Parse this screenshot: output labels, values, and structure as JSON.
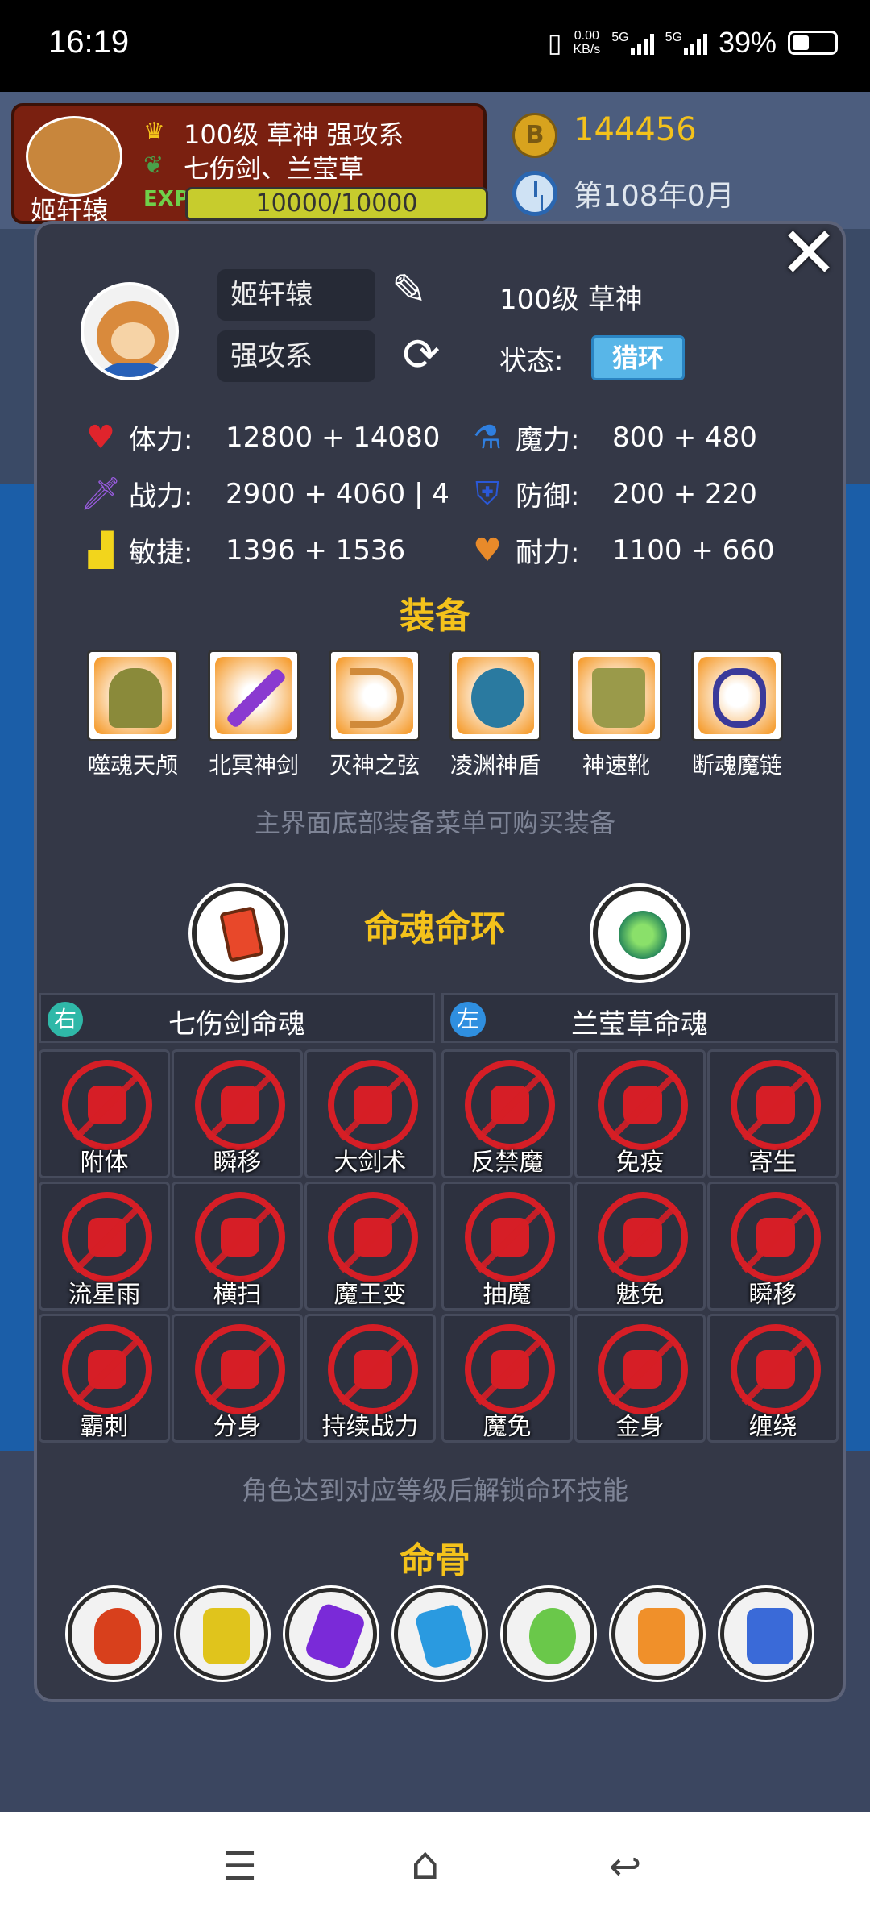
{
  "status_bar": {
    "time": "16:19",
    "net_speed_value": "0.00",
    "net_speed_unit": "KB/s",
    "sig1": "5G",
    "sig2": "5G",
    "battery": "39%",
    "battery_level": 0.39
  },
  "background": {
    "hero_name": "姬轩辕",
    "hero_line1": "100级 草神 强攻系",
    "hero_line2": "七伤剑、兰莹草",
    "exp_label": "EXP",
    "exp_value": "10000/10000",
    "coin_letter": "B",
    "coins": "144456",
    "date": "第108年0月"
  },
  "character": {
    "name": "姬轩辕",
    "type": "强攻系",
    "level_title": "100级 草神",
    "state_label": "状态:",
    "state_value": "猎环",
    "close_label": "✕"
  },
  "stats": [
    {
      "icon": "heart-icon",
      "label": "体力:",
      "value": "12800 + 14080",
      "color": "#e0242c"
    },
    {
      "icon": "mana-potion-icon",
      "label": "魔力:",
      "value": "800 + 480",
      "color": "#2f7fe0"
    },
    {
      "icon": "sword-icon",
      "label": "战力:",
      "value": "2900 + 4060 | 4",
      "color": "#9a5ce0"
    },
    {
      "icon": "shield-icon",
      "label": "防御:",
      "value": "200 + 220",
      "color": "#2a58d8"
    },
    {
      "icon": "boot-icon",
      "label": "敏捷:",
      "value": "1396 + 1536",
      "color": "#f2d51c"
    },
    {
      "icon": "stamina-heart-icon",
      "label": "耐力:",
      "value": "1100 + 660",
      "color": "#e88a2a"
    }
  ],
  "equipment": {
    "title": "装备",
    "items": [
      {
        "name": "噬魂天颅",
        "icon": "helmet-icon",
        "color": "#8a8a3a"
      },
      {
        "name": "北冥神剑",
        "icon": "sword-icon",
        "color": "#8a3ad0"
      },
      {
        "name": "灭神之弦",
        "icon": "bow-icon",
        "color": "#d08a3a"
      },
      {
        "name": "凌渊神盾",
        "icon": "shield-icon",
        "color": "#2a7aa0"
      },
      {
        "name": "神速靴",
        "icon": "boots-icon",
        "color": "#9a9a4a"
      },
      {
        "name": "断魂魔链",
        "icon": "chain-icon",
        "color": "#3a3a9a"
      }
    ],
    "hint": "主界面底部装备菜单可购买装备"
  },
  "soul_ring": {
    "title": "命魂命环",
    "left_icon": "red-gem-icon",
    "right_icon": "green-grass-icon",
    "right_column": {
      "side": "右",
      "title": "七伤剑命魂",
      "badge_color": "#2fb8a8"
    },
    "left_column": {
      "side": "左",
      "title": "兰莹草命魂",
      "badge_color": "#2f8fe0"
    },
    "skills_right": [
      "附体",
      "瞬移",
      "大剑术",
      "流星雨",
      "横扫",
      "魔王变",
      "霸刺",
      "分身",
      "持续战力"
    ],
    "skills_left": [
      "反禁魔",
      "免疫",
      "寄生",
      "抽魔",
      "魅免",
      "瞬移",
      "魔免",
      "金身",
      "缠绕"
    ],
    "hint": "角色达到对应等级后解锁命环技能"
  },
  "soul_bones": {
    "title": "命骨",
    "items": [
      {
        "icon": "fire-bone-icon",
        "color": "#d8401c"
      },
      {
        "icon": "spine-bone-icon",
        "color": "#e0c41c"
      },
      {
        "icon": "purple-bone-icon",
        "color": "#7a2ad8"
      },
      {
        "icon": "blue-bone-icon",
        "color": "#2a9ae0"
      },
      {
        "icon": "green-bone-icon",
        "color": "#6ac84a"
      },
      {
        "icon": "orange-bone-icon",
        "color": "#f0902a"
      },
      {
        "icon": "blue-wing-bone-icon",
        "color": "#3a6ad8"
      }
    ]
  },
  "nav_bar": {
    "menu": "☰",
    "home": "⌂",
    "back": "↩"
  }
}
